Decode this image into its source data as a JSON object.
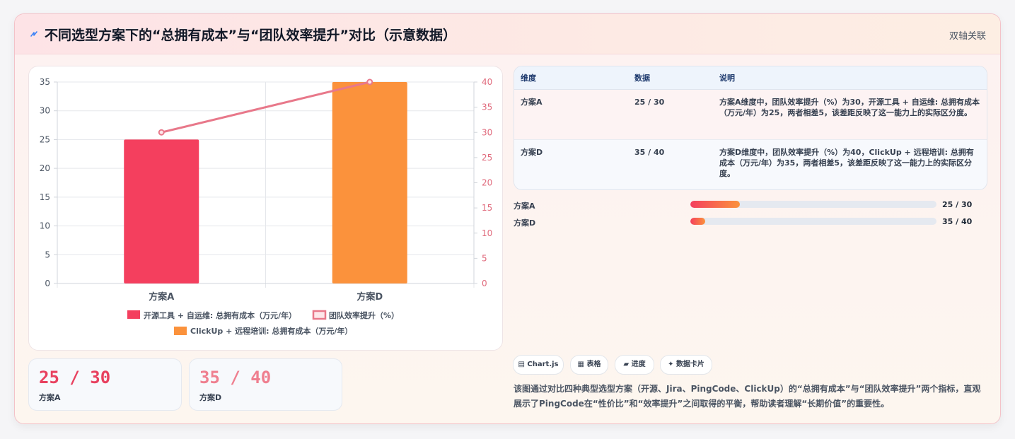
{
  "header": {
    "title": "不同选型方案下的“总拥有成本”与“团队效率提升”对比（示意数据）",
    "badge": "双轴关联",
    "icon": "lightning-bolt-icon"
  },
  "colors": {
    "series_a": "#f43f5e",
    "series_d": "#fb923c",
    "line": "#e8788a",
    "right_axis": "#e06a7c"
  },
  "chart_data": {
    "type": "bar",
    "categories": [
      "方案A",
      "方案D"
    ],
    "series": [
      {
        "name": "开源工具 + 自运维: 总拥有成本（万元/年）",
        "values": [
          25,
          null
        ],
        "axis": "left",
        "color": "#f43f5e"
      },
      {
        "name": "ClickUp + 远程培训: 总拥有成本（万元/年）",
        "values": [
          null,
          35
        ],
        "axis": "left",
        "color": "#fb923c"
      },
      {
        "name": "团队效率提升（%）",
        "type": "line",
        "values": [
          30,
          40
        ],
        "axis": "right",
        "color": "#e8788a"
      }
    ],
    "ylim_left": [
      0,
      35
    ],
    "yticks_left": [
      "0",
      "5",
      "10",
      "15",
      "20",
      "25",
      "30",
      "35"
    ],
    "ylim_right": [
      0,
      40
    ],
    "yticks_right": [
      "0",
      "5",
      "10",
      "15",
      "20",
      "25",
      "30",
      "35",
      "40"
    ],
    "grid": true,
    "legend": "bottom"
  },
  "stats": [
    {
      "value": "25 / 30",
      "label": "方案A",
      "color": "#e8415f"
    },
    {
      "value": "35 / 40",
      "label": "方案D",
      "color": "#ef7f8f"
    }
  ],
  "table": {
    "headers": [
      "维度",
      "数据",
      "说明"
    ],
    "rows": [
      {
        "dim": "方案A",
        "data": "25 / 30",
        "desc": "方案A维度中，团队效率提升（%）为30，开源工具 + 自运维: 总拥有成本（万元/年）为25，两者相差5，该差距反映了这一能力上的实际区分度。"
      },
      {
        "dim": "方案D",
        "data": "35 / 40",
        "desc": "方案D维度中，团队效率提升（%）为40，ClickUp + 远程培训: 总拥有成本（万元/年）为35，两者相差5，该差距反映了这一能力上的实际区分度。"
      }
    ]
  },
  "progress": [
    {
      "label": "方案A",
      "value": "25 / 30",
      "fraction": 0.2
    },
    {
      "label": "方案D",
      "value": "35 / 40",
      "fraction": 0.06
    }
  ],
  "chips": [
    {
      "icon": "chart-icon",
      "glyph": "▤",
      "label": "Chart.js"
    },
    {
      "icon": "table-icon",
      "glyph": "▦",
      "label": "表格"
    },
    {
      "icon": "folder-icon",
      "glyph": "▰",
      "label": "进度"
    },
    {
      "icon": "sparkle-icon",
      "glyph": "✦",
      "label": "数据卡片"
    }
  ],
  "description": "该图通过对比四种典型选型方案（开源、Jira、PingCode、ClickUp）的“总拥有成本”与“团队效率提升”两个指标，直观展示了PingCode在“性价比”和“效率提升”之间取得的平衡，帮助读者理解“长期价值”的重要性。"
}
